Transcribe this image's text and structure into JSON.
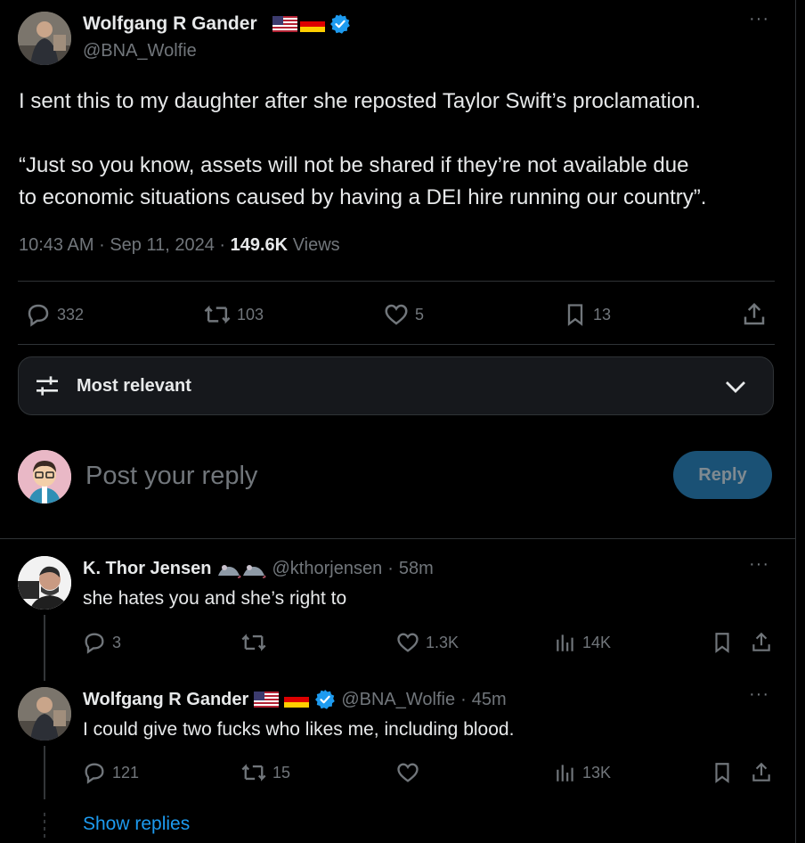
{
  "main_tweet": {
    "author_name": "Wolfgang R Gander",
    "handle": "@BNA_Wolfie",
    "text_line1": "I sent this to my daughter after she reposted Taylor Swift’s proclamation.",
    "text_line2": "“Just so you know, assets will not be shared if they’re not available due",
    "text_line3": "to economic situations caused by having a DEI hire running our country”.",
    "time": "10:43 AM",
    "date": "Sep 11, 2024",
    "views_count": "149.6K",
    "views_label": "Views",
    "replies": "332",
    "reposts": "103",
    "likes": "5",
    "bookmarks": "13"
  },
  "sort": {
    "label": "Most relevant"
  },
  "compose": {
    "placeholder": "Post your reply",
    "button_label": "Reply"
  },
  "replies": [
    {
      "author_name": "K. Thor Jensen",
      "handle": "@kthorjensen",
      "age": "58m",
      "text": "she hates you and she’s right to",
      "replies": "3",
      "reposts": "",
      "likes": "1.3K",
      "views": "14K"
    },
    {
      "author_name": "Wolfgang R Gander",
      "handle": "@BNA_Wolfie",
      "age": "45m",
      "text": "I could give two fucks who likes me, including blood.",
      "replies": "121",
      "reposts": "15",
      "likes": "",
      "views": "13K"
    }
  ],
  "show_replies": "Show replies",
  "separator": "·",
  "colors": {
    "accent": "#1d9bf0",
    "verified": "#1d9bf0",
    "reply_button": "#1a5175",
    "muted": "#71767b"
  }
}
